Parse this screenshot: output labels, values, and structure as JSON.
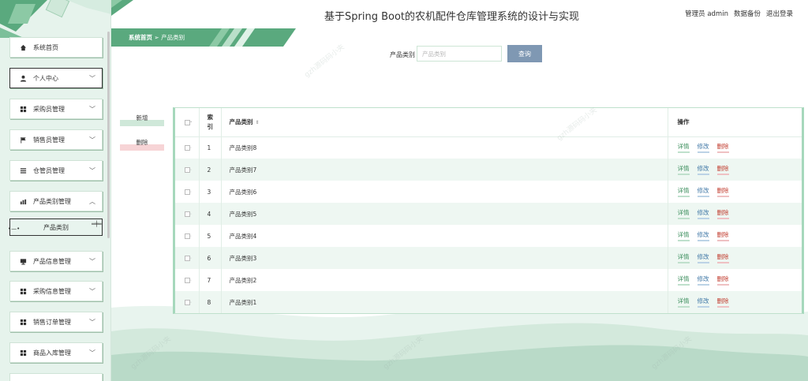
{
  "header": {
    "title": "基于Spring Boot的农机配件仓库管理系统的设计与实现",
    "user_label": "管理员 admin",
    "backup_label": "数据备份",
    "logout_label": "退出登录"
  },
  "breadcrumb": {
    "home": "系统首页",
    "separator": "➢",
    "current": "产品类别"
  },
  "sidebar": {
    "items": [
      {
        "label": "系统首页",
        "icon": "home-icon",
        "has_chevron": false
      },
      {
        "label": "个人中心",
        "icon": "user-icon",
        "has_chevron": true
      },
      {
        "label": "采购员管理",
        "icon": "grid-icon",
        "has_chevron": true
      },
      {
        "label": "销售员管理",
        "icon": "flag-icon",
        "has_chevron": true
      },
      {
        "label": "仓管员管理",
        "icon": "list-icon",
        "has_chevron": true
      },
      {
        "label": "产品类别管理",
        "icon": "chart-icon",
        "has_chevron": true,
        "expanded": true
      },
      {
        "label": "产品信息管理",
        "icon": "monitor-icon",
        "has_chevron": true
      },
      {
        "label": "采购信息管理",
        "icon": "grid-icon",
        "has_chevron": true
      },
      {
        "label": "销售订单管理",
        "icon": "grid-icon",
        "has_chevron": true
      },
      {
        "label": "商品入库管理",
        "icon": "grid-icon",
        "has_chevron": true
      }
    ],
    "sub_item": "产品类别"
  },
  "search": {
    "label": "产品类别",
    "placeholder": "产品类别",
    "button": "查询"
  },
  "actions": {
    "add": "新增",
    "delete": "删除"
  },
  "table": {
    "headers": {
      "index": "索引",
      "category": "产品类别",
      "ops": "操作"
    },
    "rows": [
      {
        "index": "1",
        "category": "产品类别8"
      },
      {
        "index": "2",
        "category": "产品类别7"
      },
      {
        "index": "3",
        "category": "产品类别6"
      },
      {
        "index": "4",
        "category": "产品类别5"
      },
      {
        "index": "5",
        "category": "产品类别4"
      },
      {
        "index": "6",
        "category": "产品类别3"
      },
      {
        "index": "7",
        "category": "产品类别2"
      },
      {
        "index": "8",
        "category": "产品类别1"
      }
    ],
    "op_labels": {
      "detail": "详情",
      "edit": "修改",
      "delete": "删除"
    }
  },
  "colors": {
    "primary_green": "#3f9b6c",
    "accent_green": "#a6d8bc",
    "search_button": "#7f98b3",
    "delete_red": "#c0392b",
    "edit_blue": "#3f77a6"
  }
}
